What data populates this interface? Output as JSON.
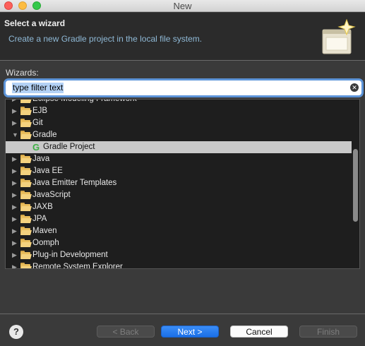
{
  "window": {
    "title": "New"
  },
  "header": {
    "title": "Select a wizard",
    "description": "Create a new Gradle project in the local file system."
  },
  "wizards": {
    "label": "Wizards:",
    "filter_value": "type filter text",
    "tree": [
      {
        "label": "Eclipse Modeling Framework",
        "expanded": false,
        "icon": "folder-icon"
      },
      {
        "label": "EJB",
        "expanded": false,
        "icon": "folder-icon"
      },
      {
        "label": "Git",
        "expanded": false,
        "icon": "folder-icon"
      },
      {
        "label": "Gradle",
        "expanded": true,
        "icon": "folder-open-icon"
      },
      {
        "label": "Gradle Project",
        "child": true,
        "selected": true,
        "icon": "gradle-icon"
      },
      {
        "label": "Java",
        "expanded": false,
        "icon": "folder-icon"
      },
      {
        "label": "Java EE",
        "expanded": false,
        "icon": "folder-icon"
      },
      {
        "label": "Java Emitter Templates",
        "expanded": false,
        "icon": "folder-icon"
      },
      {
        "label": "JavaScript",
        "expanded": false,
        "icon": "folder-icon"
      },
      {
        "label": "JAXB",
        "expanded": false,
        "icon": "folder-icon"
      },
      {
        "label": "JPA",
        "expanded": false,
        "icon": "folder-icon"
      },
      {
        "label": "Maven",
        "expanded": false,
        "icon": "folder-icon"
      },
      {
        "label": "Oomph",
        "expanded": false,
        "icon": "folder-icon"
      },
      {
        "label": "Plug-in Development",
        "expanded": false,
        "icon": "folder-icon"
      },
      {
        "label": "Remote System Explorer",
        "expanded": false,
        "icon": "folder-icon"
      }
    ]
  },
  "buttons": {
    "help": "?",
    "back": "< Back",
    "next": "Next >",
    "cancel": "Cancel",
    "finish": "Finish"
  },
  "colors": {
    "accent": "#1a6fe6",
    "selection": "#c9c9c9",
    "description": "#8fb9d6"
  }
}
